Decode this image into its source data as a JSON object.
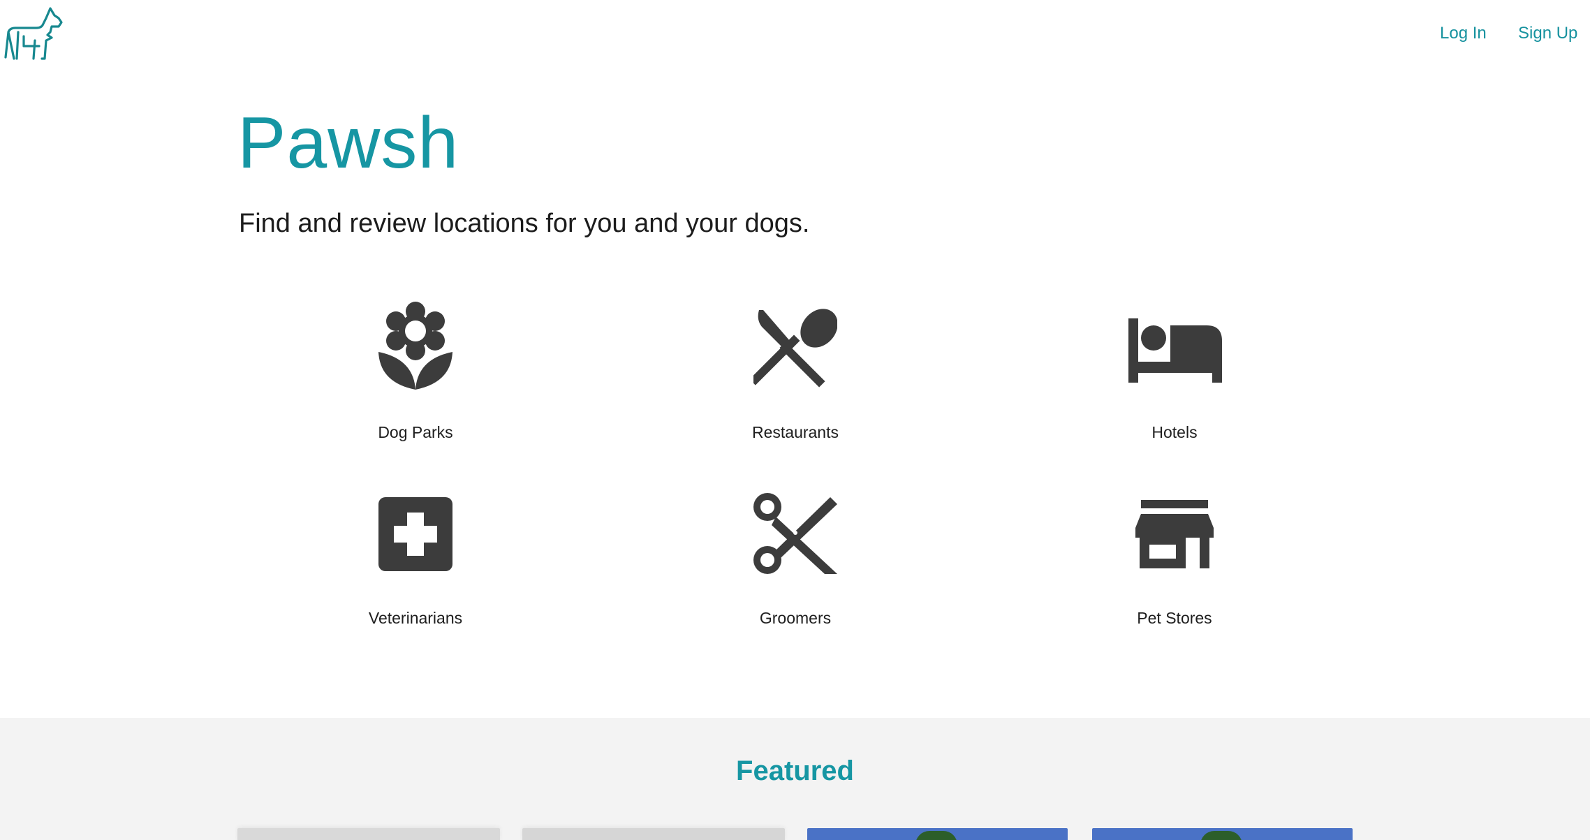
{
  "header": {
    "logo_icon": "dog-logo-icon",
    "login_label": "Log In",
    "signup_label": "Sign Up"
  },
  "hero": {
    "title": "Pawsh",
    "tagline": "Find and review locations for you and your dogs."
  },
  "categories": [
    {
      "label": "Dog Parks",
      "icon": "flower-icon"
    },
    {
      "label": "Restaurants",
      "icon": "utensils-icon"
    },
    {
      "label": "Hotels",
      "icon": "bed-icon"
    },
    {
      "label": "Veterinarians",
      "icon": "medical-cross-icon"
    },
    {
      "label": "Groomers",
      "icon": "scissors-icon"
    },
    {
      "label": "Pet Stores",
      "icon": "storefront-icon"
    }
  ],
  "featured": {
    "title": "Featured"
  },
  "colors": {
    "brand": "#1696a3",
    "link": "#17929f",
    "icon": "#3c3c3c",
    "featured_bg": "#f3f3f3"
  }
}
